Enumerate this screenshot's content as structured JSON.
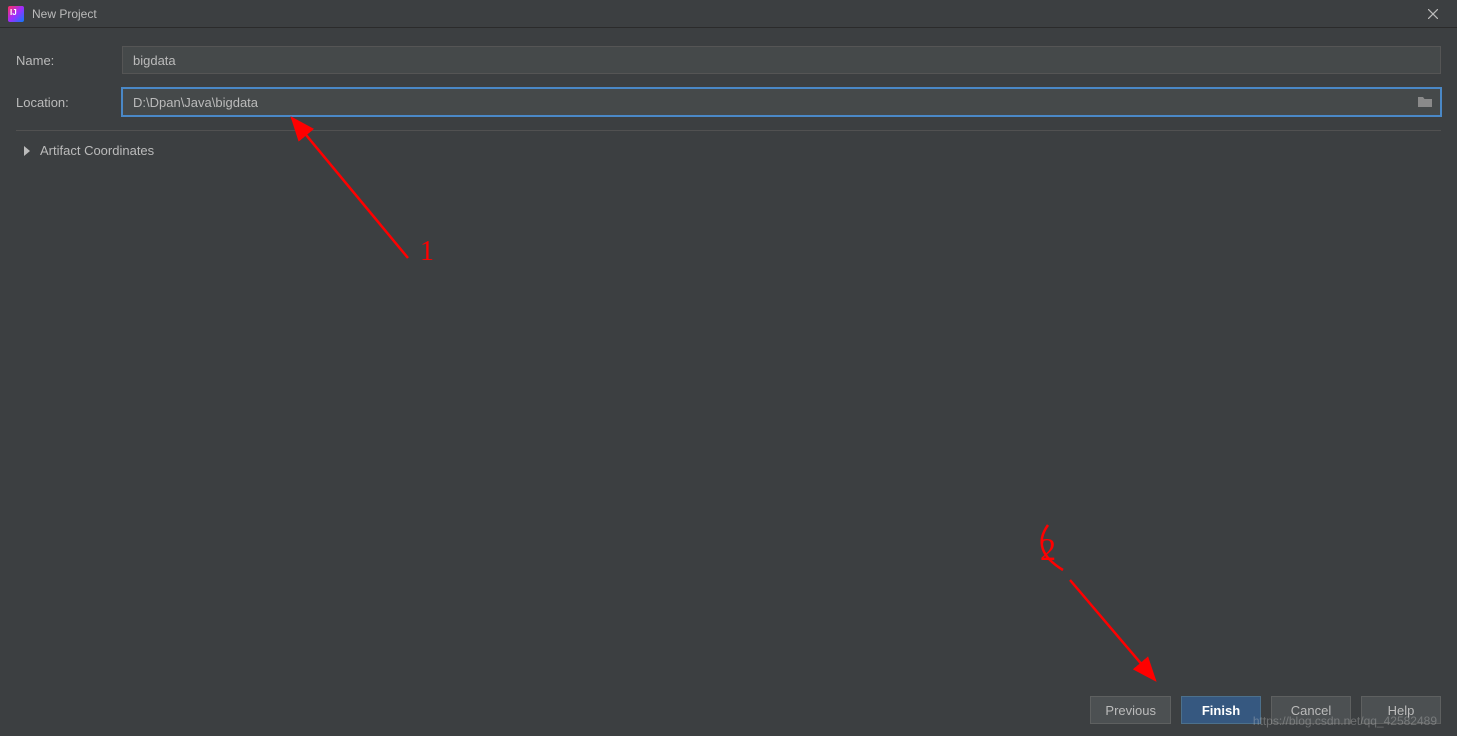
{
  "window": {
    "title": "New Project"
  },
  "form": {
    "name_label": "Name:",
    "name_value": "bigdata",
    "location_label": "Location:",
    "location_value": "D:\\Dpan\\Java\\bigdata",
    "artifact_label": "Artifact Coordinates"
  },
  "buttons": {
    "previous": "Previous",
    "finish": "Finish",
    "cancel": "Cancel",
    "help": "Help"
  },
  "annotations": {
    "marker1": "1",
    "marker2": "2"
  },
  "watermark": "https://blog.csdn.net/qq_42582489"
}
